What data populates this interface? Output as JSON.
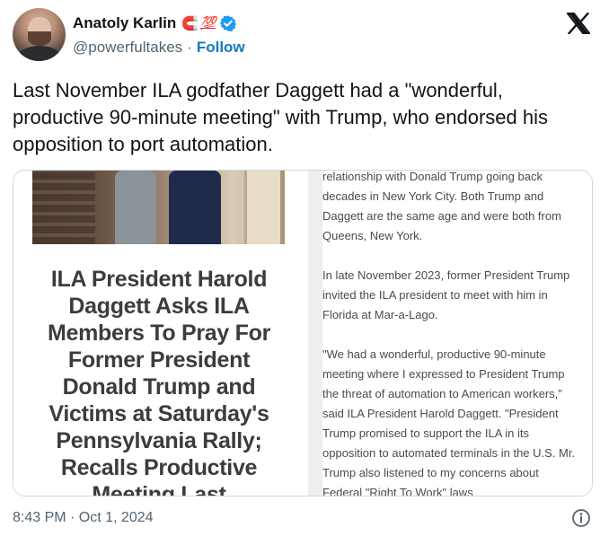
{
  "author": {
    "display_name": "Anatoly Karlin",
    "emoji_magnet": "🧲",
    "emoji_hundred": "💯",
    "handle": "@powerfultakes",
    "separator": "·",
    "follow_label": "Follow"
  },
  "tweet": {
    "text": "Last November ILA godfather Daggett had a \"wonderful, productive 90-minute meeting\" with Trump, who endorsed his opposition to port automation."
  },
  "media": {
    "headline": "ILA President Harold Daggett Asks ILA Members To Pray For Former President Donald Trump and Victims at Saturday's Pennsylvania Rally; Recalls Productive Meeting Last",
    "paragraphs": [
      "relationship with Donald Trump going back decades in New York City. Both Trump and Daggett are the same age and were both from Queens, New York.",
      "In late November 2023, former President Trump invited the ILA president to meet with him in Florida at Mar-a-Lago.",
      "\"We had a wonderful, productive 90-minute meeting where I expressed to President Trump the threat of automation to American workers,\" said ILA President Harold Daggett. \"President Trump promised to support the ILA in its opposition to automated terminals in the U.S. Mr. Trump also listened to my concerns about Federal \"Right To Work\" laws"
    ]
  },
  "footer": {
    "timestamp": "8:43 PM · Oct 1, 2024"
  },
  "colors": {
    "text": "#0f1419",
    "secondary": "#536471",
    "follow": "#0f7bbf",
    "verified": "#1d9bf0",
    "border": "#cfd9de"
  },
  "icons": {
    "verified": "verified-badge-icon",
    "brand": "x-logo-icon",
    "info": "info-icon"
  }
}
